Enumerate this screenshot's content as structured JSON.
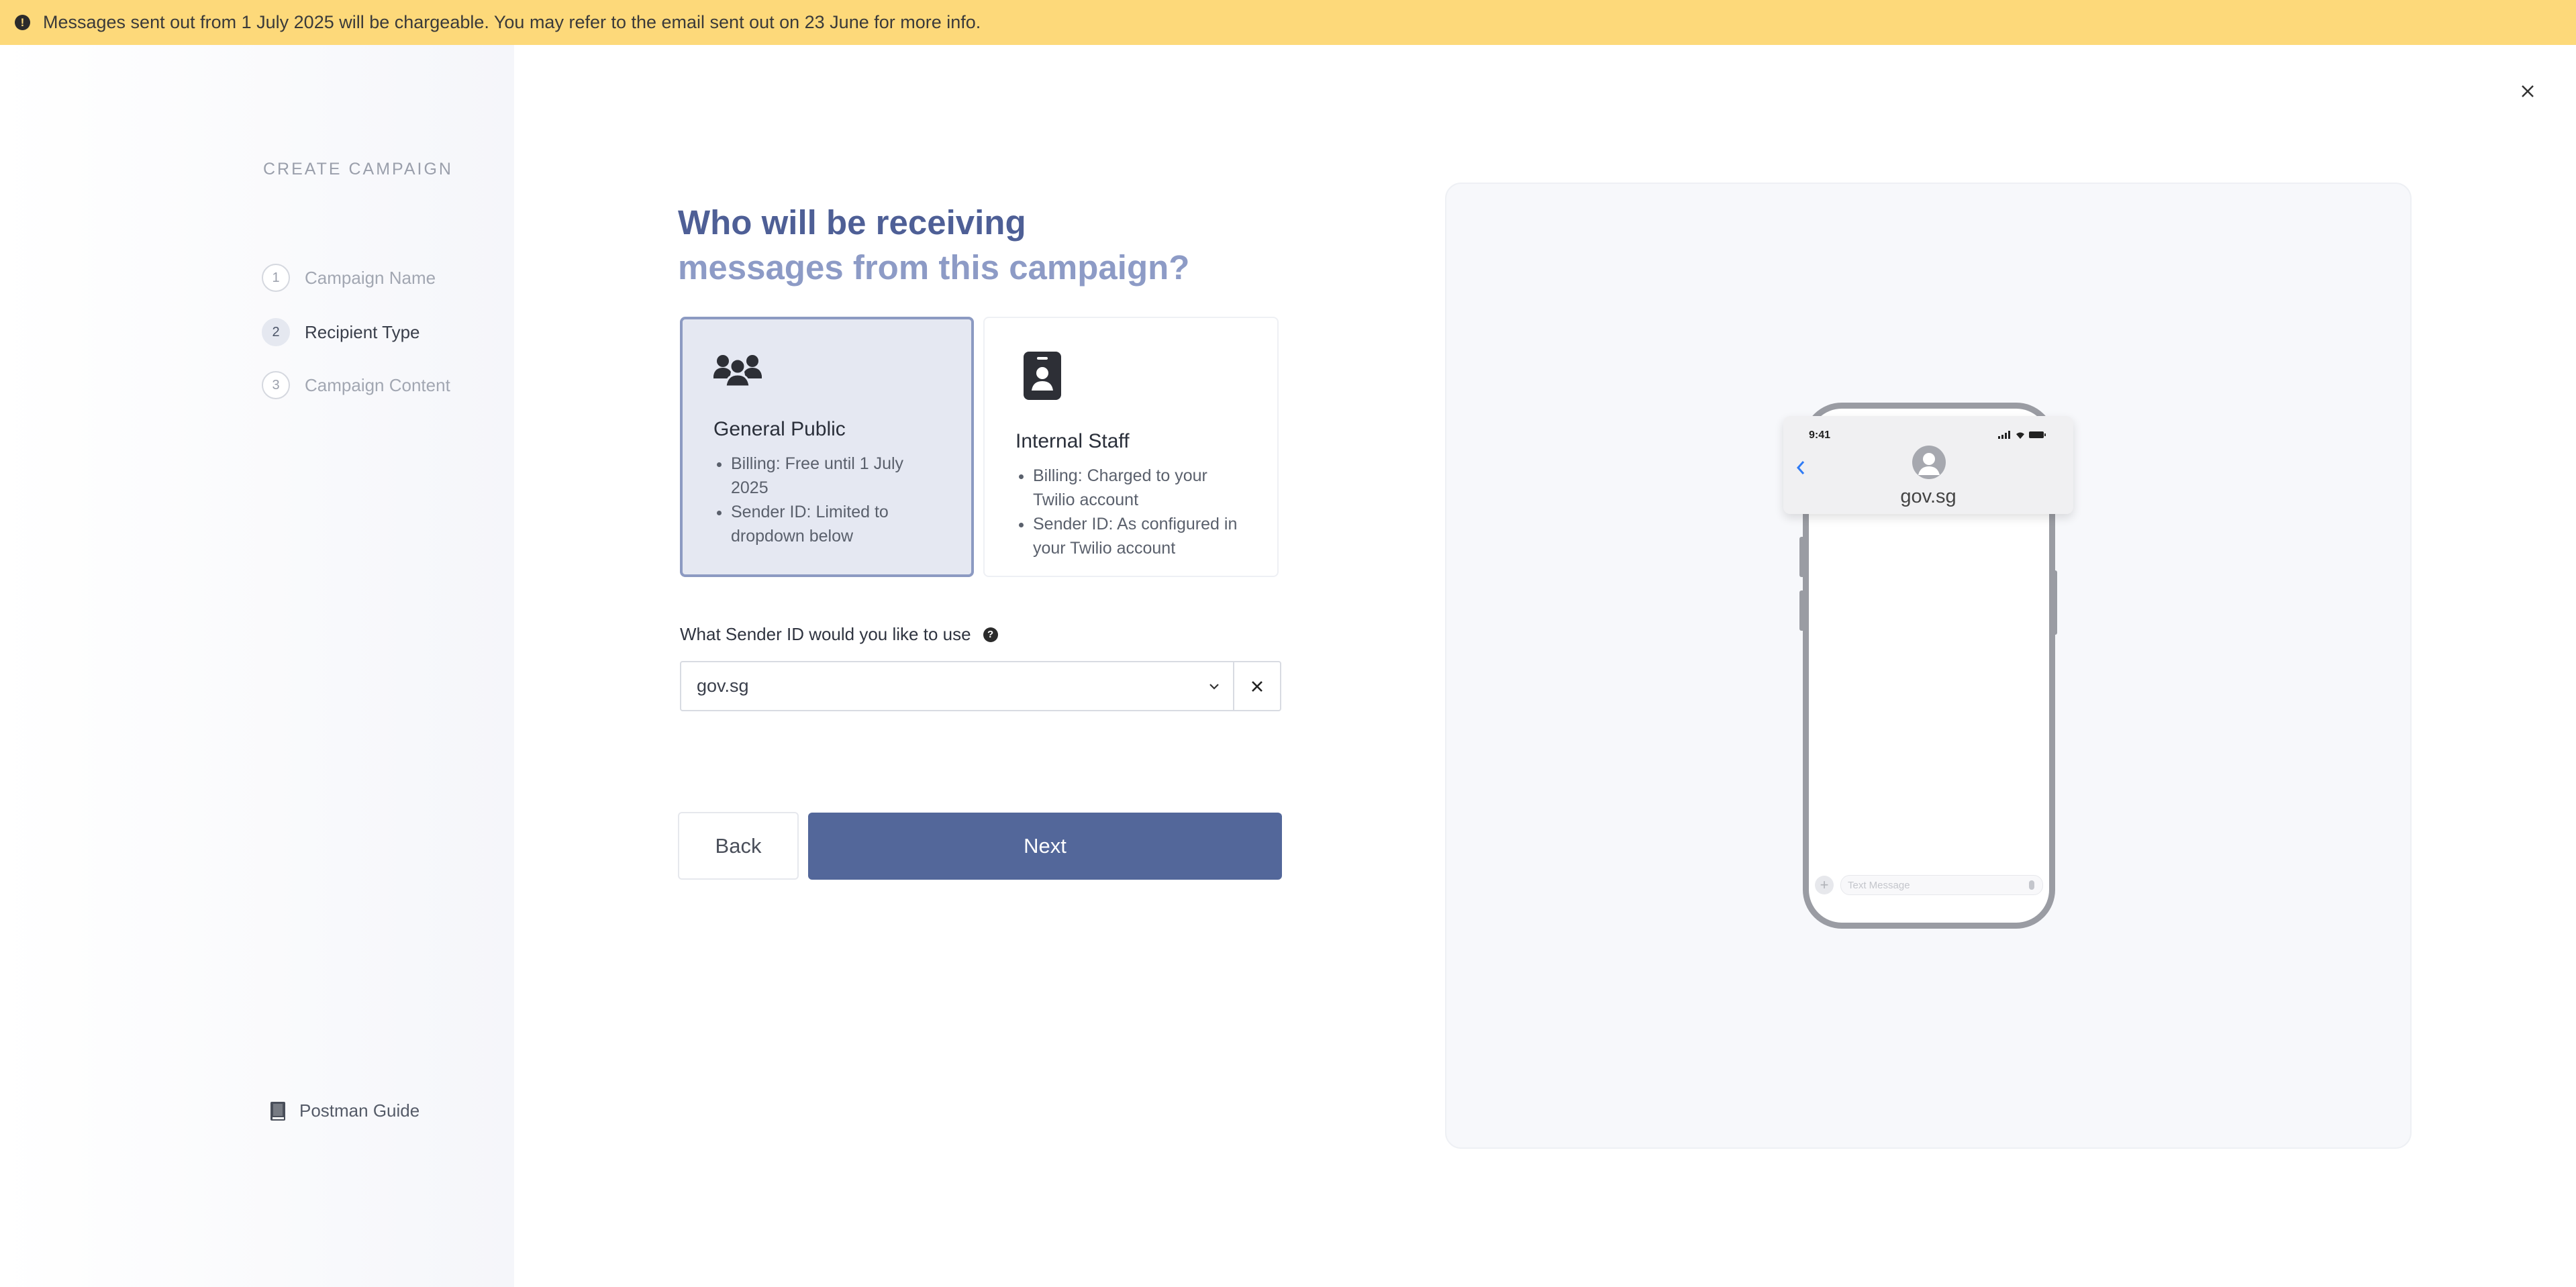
{
  "banner": {
    "icon": "alert-circle-icon",
    "text": "Messages sent out from 1 July 2025 will be chargeable. You may refer to the email sent out on 23 June for more info."
  },
  "sidebar": {
    "title": "CREATE CAMPAIGN",
    "steps": [
      {
        "number": "1",
        "label": "Campaign Name",
        "active": false
      },
      {
        "number": "2",
        "label": "Recipient Type",
        "active": true
      },
      {
        "number": "3",
        "label": "Campaign Content",
        "active": false
      }
    ],
    "guide_label": "Postman Guide",
    "guide_icon": "book-icon"
  },
  "heading": {
    "line1": "Who will be receiving",
    "line2": "messages from this campaign?"
  },
  "cards": [
    {
      "title": "General Public",
      "icon": "group-icon",
      "selected": true,
      "bullets": [
        "Billing: Free until 1 July 2025",
        "Sender ID: Limited to dropdown below"
      ]
    },
    {
      "title": "Internal Staff",
      "icon": "id-badge-icon",
      "selected": false,
      "bullets": [
        "Billing: Charged to your Twilio account",
        "Sender ID: As configured in your Twilio account"
      ]
    }
  ],
  "sender": {
    "label": "What Sender ID would you like to use",
    "help_icon": "question-circle-icon",
    "value": "gov.sg"
  },
  "buttons": {
    "back": "Back",
    "next": "Next"
  },
  "preview": {
    "time": "9:41",
    "contact": "gov.sg",
    "input_placeholder": "Text Message"
  },
  "colors": {
    "banner": "#fdd97a",
    "primary": "#53679a",
    "heading": "#4e5f96",
    "heading_light": "#8d9bc6",
    "selected_card": "#e5e8f2"
  }
}
